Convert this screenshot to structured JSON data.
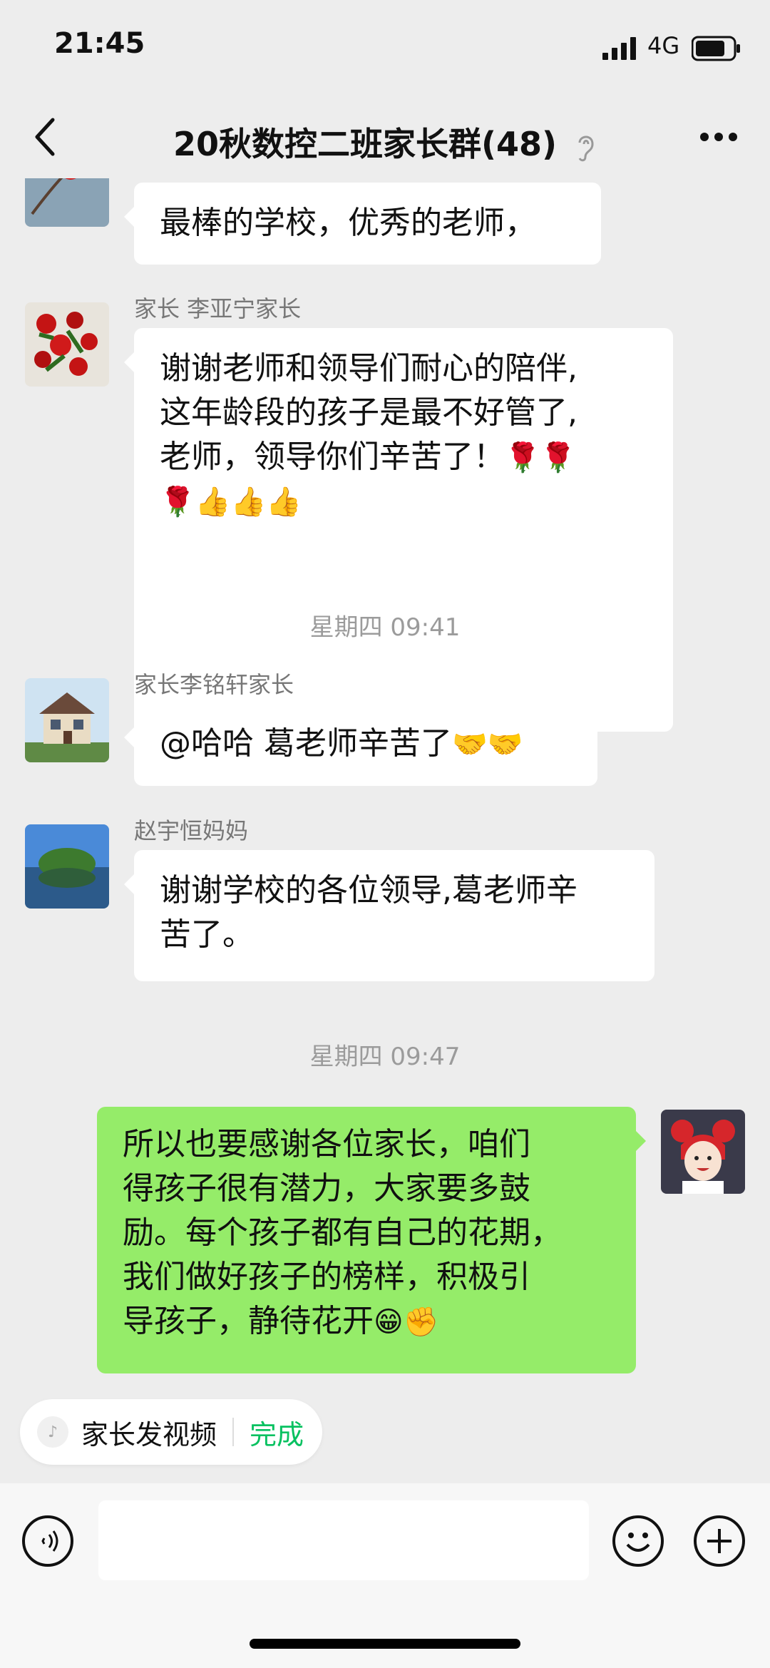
{
  "status_bar": {
    "time": "21:45",
    "network": "4G"
  },
  "nav": {
    "title": "20秋数控二班家长群(48)"
  },
  "messages": [
    {
      "side": "left",
      "sender": "",
      "text": "最棒的学校，优秀的老师，",
      "emoji": ""
    },
    {
      "side": "left",
      "sender": "家长 李亚宁家长",
      "lines": [
        "谢谢老师和领导们耐心的陪伴,",
        "这年龄段的孩子是最不好管了,",
        "老师，领导你们辛苦了！"
      ],
      "line3_emoji": "🌹🌹",
      "line4_emoji": "🌹👍👍👍"
    },
    {
      "type": "time",
      "text": "星期四 09:41"
    },
    {
      "side": "left",
      "sender": "家长李铭轩家长",
      "text": "@哈哈 葛老师辛苦了",
      "emoji": "🤝🤝"
    },
    {
      "side": "left",
      "sender": "赵宇恒妈妈",
      "lines": [
        "谢谢学校的各位领导,葛老师辛",
        "苦了。"
      ]
    },
    {
      "type": "time",
      "text": "星期四 09:47"
    },
    {
      "side": "right",
      "lines": [
        "所以也要感谢各位家长，咱们",
        "得孩子很有潜力，大家要多鼓",
        "励。每个孩子都有自己的花期，",
        "我们做好孩子的榜样，积极引",
        "导孩子，静待花开"
      ],
      "emoji": "😁✊"
    }
  ],
  "chip": {
    "label": "家长发视频",
    "action": "完成"
  },
  "icons": {
    "back": "chevron-left-icon",
    "ear": "ear-icon",
    "more": "more-dots-icon",
    "voice": "voice-icon",
    "emoji": "emoji-icon",
    "add": "plus-icon"
  },
  "colors": {
    "accent": "#07C160",
    "self_bubble": "#95EC69",
    "bg": "#EDEDED"
  }
}
